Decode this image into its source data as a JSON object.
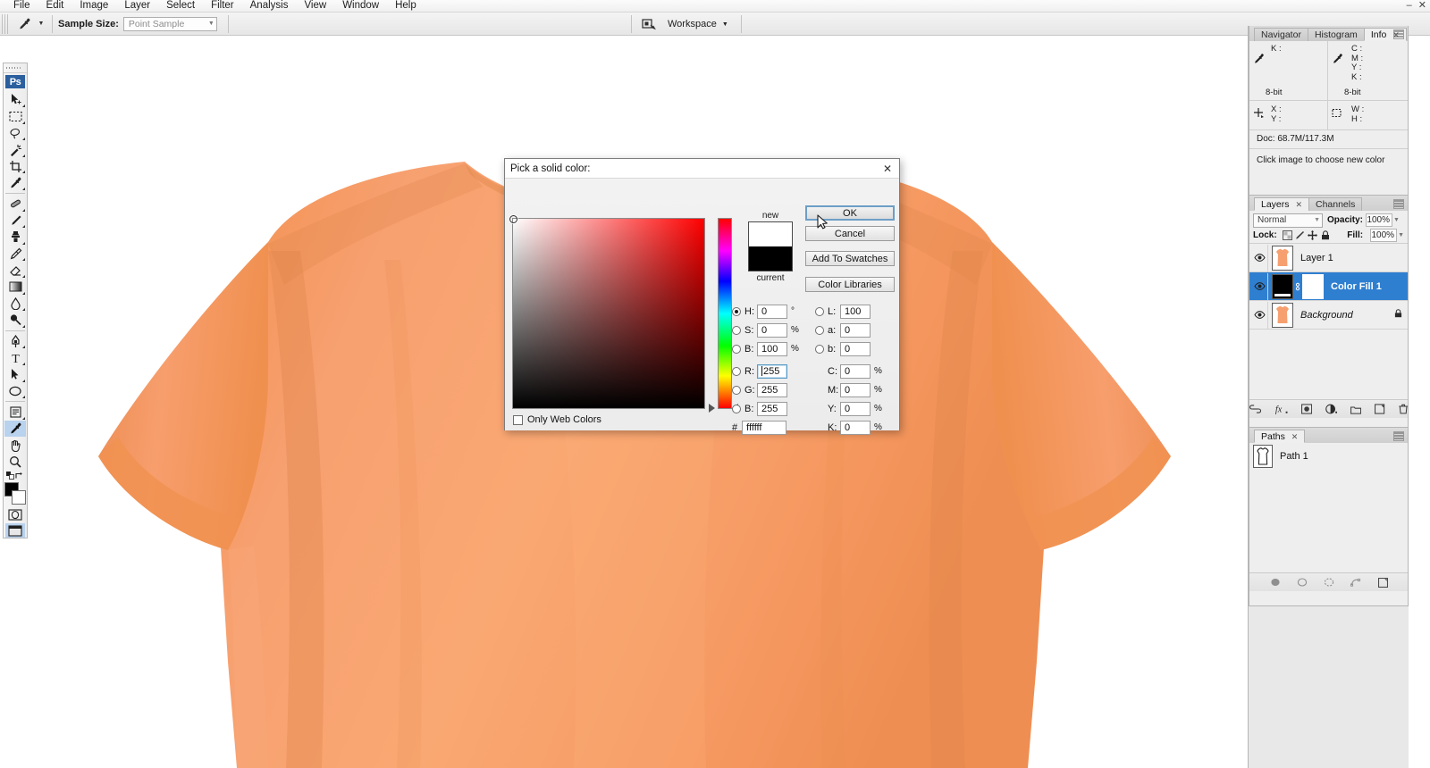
{
  "app": {
    "name": "Adobe Photoshop",
    "logo": "Ps"
  },
  "menubar": {
    "items": [
      {
        "label": "File"
      },
      {
        "label": "Edit"
      },
      {
        "label": "Image"
      },
      {
        "label": "Layer"
      },
      {
        "label": "Select"
      },
      {
        "label": "Filter"
      },
      {
        "label": "Analysis"
      },
      {
        "label": "View"
      },
      {
        "label": "Window"
      },
      {
        "label": "Help"
      }
    ],
    "window_controls": {
      "minimize": "–",
      "close": "✕"
    }
  },
  "options_bar": {
    "active_tool": "eyedropper-tool",
    "sample_size_label": "Sample Size:",
    "sample_size_value": "Point Sample",
    "workspace_label": "Workspace",
    "workspace_caret": "▼"
  },
  "toolbar": {
    "tools": [
      {
        "name": "move-tool",
        "selected": false
      },
      {
        "name": "rectangular-marquee-tool",
        "selected": false
      },
      {
        "name": "lasso-tool",
        "selected": false
      },
      {
        "name": "magic-wand-tool",
        "selected": false
      },
      {
        "name": "crop-tool",
        "selected": false
      },
      {
        "name": "eyedropper-tool-top",
        "selected": false
      },
      {
        "name": "healing-brush-tool",
        "selected": false
      },
      {
        "name": "brush-tool",
        "selected": false
      },
      {
        "name": "clone-stamp-tool",
        "selected": false
      },
      {
        "name": "history-brush-tool",
        "selected": false
      },
      {
        "name": "eraser-tool",
        "selected": false
      },
      {
        "name": "gradient-tool",
        "selected": false
      },
      {
        "name": "blur-tool",
        "selected": false
      },
      {
        "name": "dodge-tool",
        "selected": false
      },
      {
        "name": "pen-tool",
        "selected": false
      },
      {
        "name": "type-tool",
        "selected": false
      },
      {
        "name": "path-selection-tool",
        "selected": false
      },
      {
        "name": "ellipse-shape-tool",
        "selected": false
      },
      {
        "name": "notes-tool",
        "selected": false
      },
      {
        "name": "eyedropper-tool",
        "selected": true
      },
      {
        "name": "hand-tool",
        "selected": false
      },
      {
        "name": "zoom-tool",
        "selected": false
      }
    ],
    "foreground_color": "#000000",
    "background_color": "#ffffff"
  },
  "info_panel": {
    "tabs": [
      {
        "label": "Navigator",
        "active": false,
        "closable": false
      },
      {
        "label": "Histogram",
        "active": false,
        "closable": false
      },
      {
        "label": "Info",
        "active": true,
        "closable": true
      }
    ],
    "left_readout": {
      "labels": [
        "K :"
      ],
      "bit_depth": "8-bit"
    },
    "right_readout": {
      "labels": [
        "C :",
        "M :",
        "Y :",
        "K :"
      ],
      "bit_depth": "8-bit"
    },
    "coords": {
      "x_label": "X :",
      "y_label": "Y :"
    },
    "dimensions": {
      "w_label": "W :",
      "h_label": "H :"
    },
    "doc_size": "Doc: 68.7M/117.3M",
    "hint": "Click image to choose new color"
  },
  "layers_panel": {
    "tabs": [
      {
        "label": "Layers",
        "active": true,
        "closable": true
      },
      {
        "label": "Channels",
        "active": false,
        "closable": false
      }
    ],
    "blend_mode": "Normal",
    "opacity_label": "Opacity:",
    "opacity_value": "100%",
    "lock_label": "Lock:",
    "lock_icons": [
      "lock-transparent-pixels-icon",
      "lock-image-pixels-icon",
      "lock-position-icon",
      "lock-all-icon"
    ],
    "fill_label": "Fill:",
    "fill_value": "100%",
    "layers": [
      {
        "name": "Layer 1",
        "visible": true,
        "active": false,
        "italic": false,
        "locked": false,
        "thumb": "shirt"
      },
      {
        "name": "Color Fill 1",
        "visible": true,
        "active": true,
        "italic": false,
        "locked": false,
        "thumb": "fill-mask"
      },
      {
        "name": "Background",
        "visible": true,
        "active": false,
        "italic": true,
        "locked": true,
        "thumb": "shirt"
      }
    ],
    "bottom_buttons": [
      "link-layers-icon",
      "layer-style-icon",
      "layer-mask-icon",
      "adjustment-layer-icon",
      "new-group-icon",
      "new-layer-icon",
      "delete-layer-icon"
    ]
  },
  "paths_panel": {
    "tabs": [
      {
        "label": "Paths",
        "active": true,
        "closable": true
      }
    ],
    "paths": [
      {
        "name": "Path 1"
      }
    ],
    "bottom_buttons": [
      "fill-path-icon",
      "stroke-path-icon",
      "path-as-selection-icon",
      "selection-to-path-icon",
      "new-path-icon",
      "delete-path-icon"
    ]
  },
  "color_picker": {
    "title": "Pick a solid color:",
    "close_glyph": "✕",
    "new_label": "new",
    "current_label": "current",
    "new_color": "#ffffff",
    "current_color": "#000000",
    "field_hue_color": "#ff0000",
    "buttons": {
      "ok": "OK",
      "cancel": "Cancel",
      "add_to_swatches": "Add To Swatches",
      "color_libraries": "Color Libraries"
    },
    "hsb": [
      {
        "key": "H",
        "label": "H:",
        "value": "0",
        "unit": "°",
        "selected": true
      },
      {
        "key": "S",
        "label": "S:",
        "value": "0",
        "unit": "%",
        "selected": false
      },
      {
        "key": "B",
        "label": "B:",
        "value": "100",
        "unit": "%",
        "selected": false
      }
    ],
    "rgb": [
      {
        "key": "R",
        "label": "R:",
        "value": "255",
        "unit": "",
        "selected": false,
        "focused": true
      },
      {
        "key": "G",
        "label": "G:",
        "value": "255",
        "unit": "",
        "selected": false,
        "focused": false
      },
      {
        "key": "B",
        "label": "B:",
        "value": "255",
        "unit": "",
        "selected": false,
        "focused": false
      }
    ],
    "lab": [
      {
        "key": "L",
        "label": "L:",
        "value": "100",
        "unit": "",
        "selected": false
      },
      {
        "key": "a",
        "label": "a:",
        "value": "0",
        "unit": "",
        "selected": false
      },
      {
        "key": "b",
        "label": "b:",
        "value": "0",
        "unit": "",
        "selected": false
      }
    ],
    "cmyk": [
      {
        "key": "C",
        "label": "C:",
        "value": "0",
        "unit": "%"
      },
      {
        "key": "M",
        "label": "M:",
        "value": "0",
        "unit": "%"
      },
      {
        "key": "Y",
        "label": "Y:",
        "value": "0",
        "unit": "%"
      },
      {
        "key": "K",
        "label": "K:",
        "value": "0",
        "unit": "%"
      }
    ],
    "hex_label": "#",
    "hex_value": "ffffff",
    "only_web_colors": {
      "label": "Only Web Colors",
      "checked": false
    }
  },
  "canvas": {
    "document_name": "t-shirt",
    "shirt_color": "#f59a66",
    "shirt_shadow_color": "#e08a58",
    "background": "#ffffff"
  }
}
